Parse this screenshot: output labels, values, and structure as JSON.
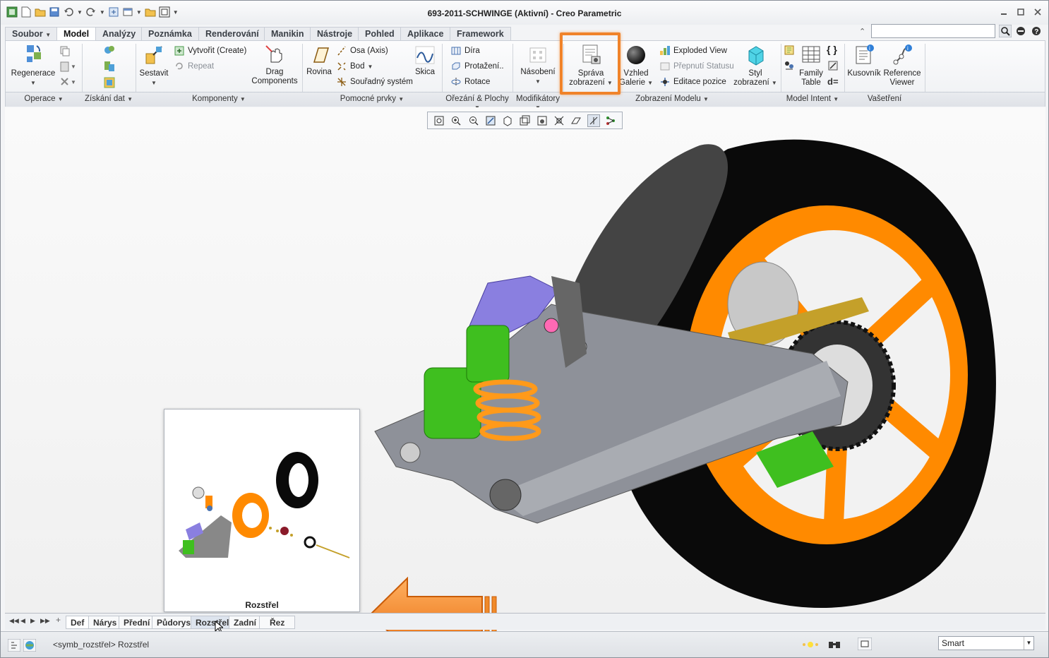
{
  "window": {
    "title": "693-2011-SCHWINGE (Aktivní) - Creo Parametric"
  },
  "ribbon_tabs": [
    "Soubor",
    "Model",
    "Analýzy",
    "Poznámka",
    "Renderování",
    "Manikin",
    "Nástroje",
    "Pohled",
    "Aplikace",
    "Framework"
  ],
  "active_tab": "Model",
  "ribbon": {
    "regenerace": "Regenerace",
    "sestavit": "Sestavit",
    "vytvorit": "Vytvořit (Create)",
    "repeat": "Repeat",
    "drag": "Drag Components",
    "rovina": "Rovina",
    "osa": "Osa (Axis)",
    "bod": "Bod",
    "souradny": "Souřadný systém",
    "skica": "Skica",
    "dira": "Díra",
    "protazeni": "Protažení..",
    "rotace": "Rotace",
    "nasobeni": "Násobení",
    "sprava_1": "Správa",
    "sprava_2": "zobrazení",
    "vzhled_1": "Vzhled",
    "vzhled_2": "Galerie",
    "exploded": "Exploded View",
    "prepnuti": "Přepnutí Statusu",
    "editace": "Editace pozice",
    "styl_1": "Styl",
    "styl_2": "zobrazení",
    "family_1": "Family",
    "family_2": "Table",
    "kusovnik": "Kusovník",
    "reference_1": "Reference",
    "reference_2": "Viewer"
  },
  "groups": {
    "operace": "Operace",
    "ziskani": "Získání dat",
    "komponenty": "Komponenty",
    "pomocne": "Pomocné prvky",
    "orezani": "Ořezání & Plochy",
    "modifikatory": "Modifikátory",
    "zobrazeni": "Zobrazení Modelu",
    "intent": "Model Intent",
    "vasetreni": "Vašetření"
  },
  "preview": {
    "label": "Rozstřel"
  },
  "view_tabs": [
    "Def",
    "Nárys",
    "Přední",
    "Půdorys",
    "Rozstřel",
    "Zadní",
    "Řez"
  ],
  "status": {
    "message": "<symb_rozstřel> Rozstřel",
    "filter": "Smart"
  },
  "colors": {
    "accent_orange": "#f0832a",
    "wheel_orange": "#ff8a00",
    "tire": "#0a0a0a",
    "swingarm": "#8e9199",
    "spring": "#ff9a1a",
    "shock_green": "#3fbf1f",
    "link_purple": "#8a7fe0"
  }
}
